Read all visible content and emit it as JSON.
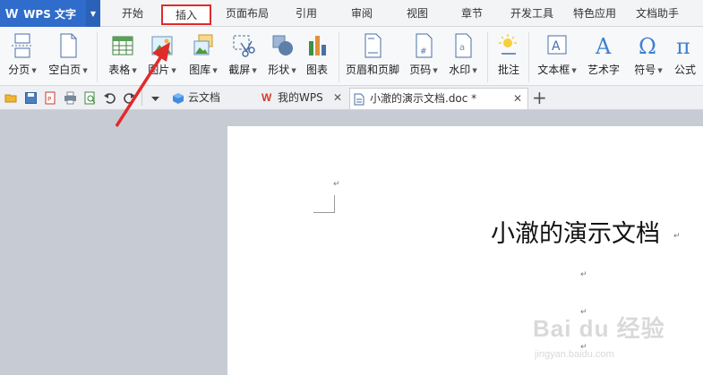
{
  "app": {
    "logo_text": "WPS 文字"
  },
  "menu_tabs": [
    "开始",
    "插入",
    "页面布局",
    "引用",
    "审阅",
    "视图",
    "章节",
    "开发工具",
    "特色应用",
    "文档助手"
  ],
  "active_tab": "插入",
  "ribbon": {
    "page_break": "分页",
    "blank_page": "空白页",
    "table": "表格",
    "picture": "图片",
    "gallery": "图库",
    "screenshot": "截屏",
    "shapes": "形状",
    "chart": "图表",
    "header_footer": "页眉和页脚",
    "page_number": "页码",
    "watermark": "水印",
    "comment": "批注",
    "textbox": "文本框",
    "wordart": "艺术字",
    "symbol": "符号",
    "formula": "公式"
  },
  "doc_tabs": {
    "cloud": "云文档",
    "mywps": "我的WPS",
    "current": "小澈的演示文档.doc *"
  },
  "document": {
    "title": "小澈的演示文档"
  },
  "watermark": {
    "brand": "Bai du 经验",
    "url": "jingyan.baidu.com"
  },
  "colors": {
    "logo_bg": "#2f6ccb",
    "highlight": "#e02b2b",
    "workspace": "#c7ccd4"
  }
}
